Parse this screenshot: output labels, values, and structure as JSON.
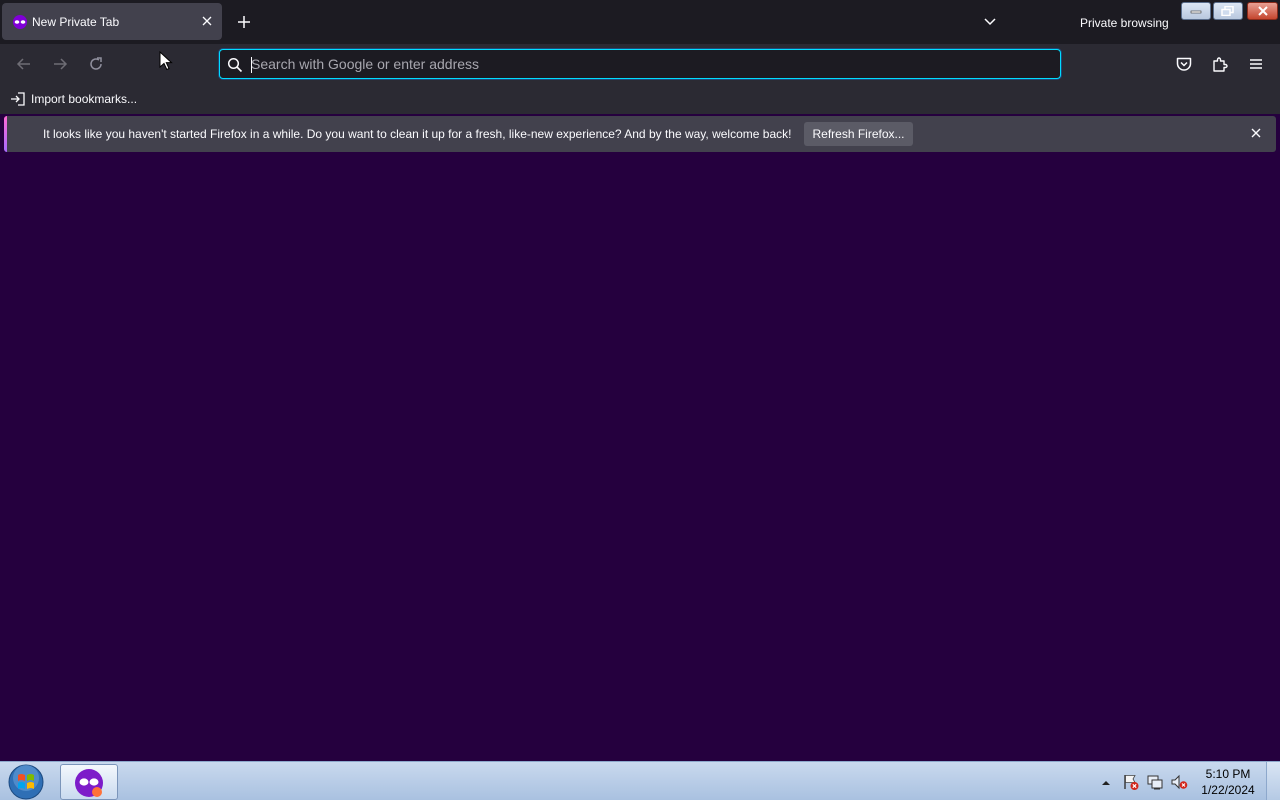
{
  "tabs": [
    {
      "title": "New Private Tab",
      "icon": "private-mask-icon",
      "active": true
    }
  ],
  "tabstrip": {
    "private_label": "Private browsing"
  },
  "urlbar": {
    "placeholder": "Search with Google or enter address",
    "value": ""
  },
  "bookmarks": {
    "import_label": "Import bookmarks..."
  },
  "notification": {
    "message": "It looks like you haven't started Firefox in a while. Do you want to clean it up for a fresh, like-new experience? And by the way, welcome back!",
    "button_label": "Refresh Firefox..."
  },
  "taskbar": {
    "time": "5:10 PM",
    "date": "1/22/2024"
  },
  "colors": {
    "content_bg": "#25003e",
    "toolbar_bg": "#2b2a33",
    "tabstrip_bg": "#1c1b22",
    "focus_ring": "#00ddff"
  }
}
